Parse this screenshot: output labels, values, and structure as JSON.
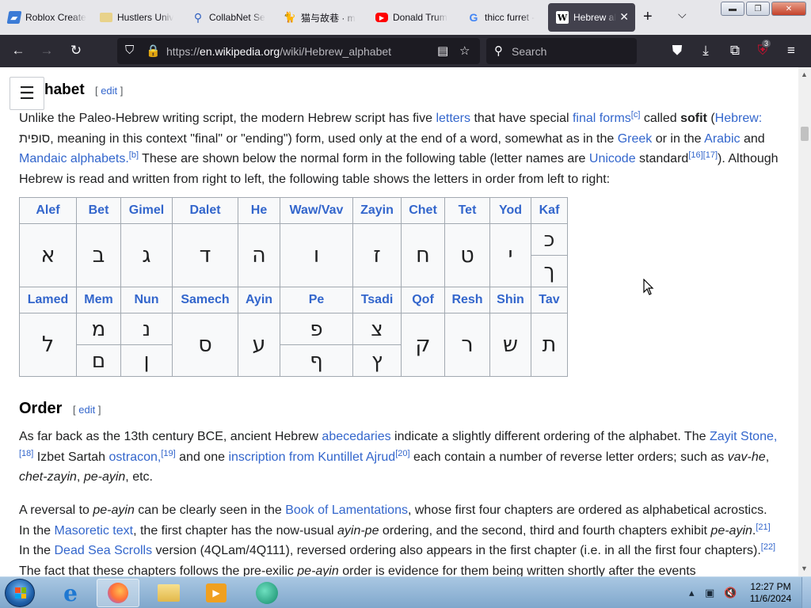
{
  "browser": {
    "tabs": [
      {
        "title": "Roblox Create",
        "icon": "roblox-icon",
        "favicon_color": "#3b7bd6"
      },
      {
        "title": "Hustlers Univ",
        "icon": "folder-icon",
        "favicon_color": "#e8d28a"
      },
      {
        "title": "CollabNet Se",
        "icon": "search-icon",
        "favicon_color": "#3060c0"
      },
      {
        "title": "猫与故巷 · m",
        "icon": "cat-icon",
        "favicon_color": "#111111"
      },
      {
        "title": "Donald Trum",
        "icon": "youtube-icon",
        "favicon_color": "#ff0000"
      },
      {
        "title": "thicc furret -",
        "icon": "google-icon",
        "favicon_color": "#4285f4"
      },
      {
        "title": "Hebrew alp",
        "icon": "wikipedia-icon",
        "favicon_color": "#ffffff",
        "active": true
      }
    ],
    "new_tab_glyph": "+",
    "tab_list_glyph": "⌵",
    "url_domain": "en.wikipedia.org",
    "url_prefix": "https://",
    "url_path": "/wiki/Hebrew_alphabet",
    "search_placeholder": "Search",
    "extension_badge": "3"
  },
  "article": {
    "section_title_partial": "habet",
    "edit_label": "edit",
    "para1": {
      "t1": "Unlike the Paleo-Hebrew writing script, the modern Hebrew script has five ",
      "l_letters": "letters",
      "t2": " that have special ",
      "l_final": "final forms",
      "s_c": "[c]",
      "t3": " called ",
      "sofit": "sofit",
      "t4": " (",
      "l_hebrew": "Hebrew:",
      "t5": " סופית, meaning in this context \"final\" or \"ending\") form, used only at the end of a word, somewhat as in the ",
      "l_greek": "Greek",
      "t6": " or in the ",
      "l_arabic": "Arabic",
      "t7": " and ",
      "l_mandaic": "Mandaic alphabets.",
      "s_b": "[b]",
      "t8": " These are shown below the normal form in the following table (letter names are ",
      "l_unicode": "Unicode",
      "t9": " standard",
      "s_16": "[16]",
      "s_17": "[17]",
      "t10": "). Although Hebrew is read and written from right to left, the following table shows the letters in order from left to right:"
    },
    "table": {
      "row1_names": [
        "Alef",
        "Bet",
        "Gimel",
        "Dalet",
        "He",
        "Waw/Vav",
        "Zayin",
        "Chet",
        "Tet",
        "Yod",
        "Kaf"
      ],
      "row1_letters": [
        "א",
        "ב",
        "ג",
        "ד",
        "ה",
        "ו",
        "ז",
        "ח",
        "ט",
        "י",
        "כ"
      ],
      "kaf_final": "ך",
      "row2_names": [
        "Lamed",
        "Mem",
        "Nun",
        "Samech",
        "Ayin",
        "Pe",
        "Tsadi",
        "Qof",
        "Resh",
        "Shin",
        "Tav"
      ],
      "row2_letters": [
        "ל",
        "מ",
        "נ",
        "ס",
        "ע",
        "פ",
        "צ",
        "ק",
        "ר",
        "ש",
        "ת"
      ],
      "mem_final": "ם",
      "nun_final": "ן",
      "pe_final": "ף",
      "tsadi_final": "ץ"
    },
    "order_heading": "Order",
    "para2": {
      "t1": "As far back as the 13th century BCE, ancient Hebrew ",
      "l_abecedaries": "abecedaries",
      "t2": " indicate a slightly different ordering of the alphabet. The ",
      "l_zayit": "Zayit Stone,",
      "s_18": "[18]",
      "t3": " Izbet Sartah ",
      "l_ostracon": "ostracon,",
      "s_19": "[19]",
      "t4": " and one ",
      "l_kuntillet": "inscription from Kuntillet Ajrud",
      "s_20": "[20]",
      "t5": " each contain a number of reverse letter orders; such as ",
      "i1": "vav-he",
      "c1": ", ",
      "i2": "chet-zayin",
      "c2": ", ",
      "i3": "pe-ayin",
      "t6": ", etc."
    },
    "para3": {
      "t1": "A reversal to ",
      "i1": "pe-ayin",
      "t2": " can be clearly seen in the ",
      "l_lament": "Book of Lamentations",
      "t3": ", whose first four chapters are ordered as alphabetical acrostics. In the ",
      "l_masoretic": "Masoretic text",
      "t4": ", the first chapter has the now-usual ",
      "i2": "ayin-pe",
      "t5": " ordering, and the second, third and fourth chapters exhibit ",
      "i3": "pe-ayin",
      "t6": ".",
      "s_21": "[21]",
      "t7": " In the ",
      "l_dss": "Dead Sea Scrolls",
      "t8": " version (4QLam/4Q111), reversed ordering also appears in the first chapter (i.e. in all the first four chapters).",
      "s_22": "[22]",
      "t9": " The fact that these chapters follows the pre-exilic ",
      "i4": "pe-ayin",
      "t10": " order is evidence for them being written shortly after the events"
    }
  },
  "taskbar": {
    "time": "12:27 PM",
    "date": "11/6/2024"
  }
}
